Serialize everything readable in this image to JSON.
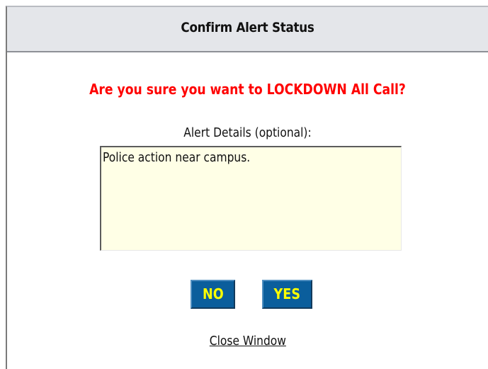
{
  "dialog": {
    "title": "Confirm Alert Status",
    "question": "Are you sure you want to LOCKDOWN All Call?",
    "details_label": "Alert Details (optional):",
    "details_value": "Police action near campus.",
    "no_label": "NO",
    "yes_label": "YES",
    "close_label": "Close Window"
  },
  "colors": {
    "title_bar": "#e4e6ea",
    "question_text": "#ff0000",
    "textarea_background": "#ffffe6",
    "button_background": "#0b5e9c",
    "button_text": "#ffff00"
  }
}
